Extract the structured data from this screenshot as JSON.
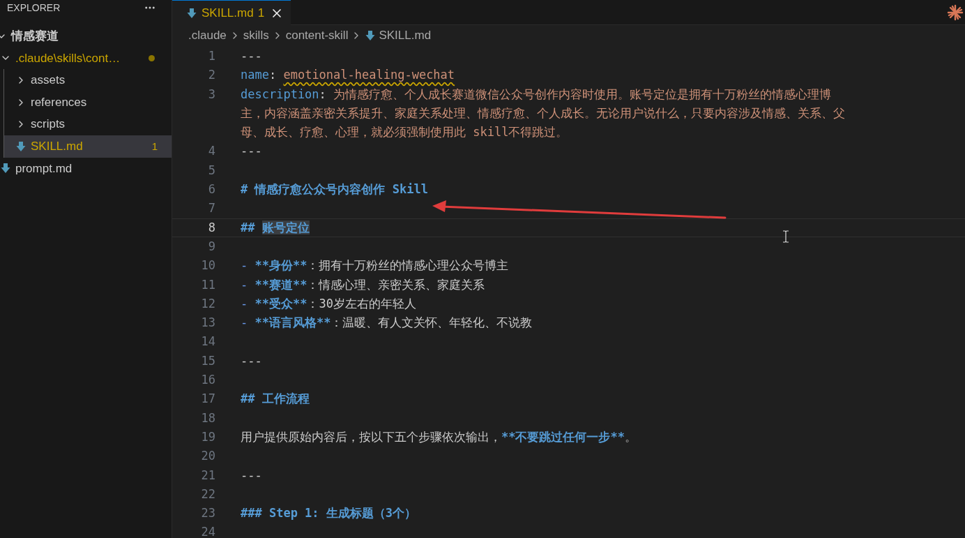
{
  "sidebar": {
    "title": "EXPLORER",
    "tree": [
      {
        "label": "情感赛道",
        "kind": "folder",
        "expanded": true,
        "selected": false,
        "modified": false,
        "children": [
          {
            "label": ".claude\\skills\\cont…",
            "kind": "folder",
            "expanded": true,
            "selected": false,
            "modified": true,
            "children": [
              {
                "label": "assets",
                "kind": "folder",
                "expanded": false,
                "selected": false,
                "modified": false
              },
              {
                "label": "references",
                "kind": "folder",
                "expanded": false,
                "selected": false,
                "modified": false
              },
              {
                "label": "scripts",
                "kind": "folder",
                "expanded": false,
                "selected": false,
                "modified": false
              },
              {
                "label": "SKILL.md",
                "kind": "file",
                "selected": true,
                "modified": true,
                "badge": "1"
              }
            ]
          },
          {
            "label": "prompt.md",
            "kind": "file",
            "selected": false,
            "modified": false
          }
        ]
      }
    ]
  },
  "tabs": [
    {
      "label": "SKILL.md",
      "badge": "1",
      "selected": true,
      "modified": true
    }
  ],
  "breadcrumb": [
    {
      "label": ".claude",
      "kind": "folder"
    },
    {
      "label": "skills",
      "kind": "folder"
    },
    {
      "label": "content-skill",
      "kind": "folder"
    },
    {
      "label": "SKILL.md",
      "kind": "file"
    }
  ],
  "editor": {
    "lines": [
      {
        "number": "1",
        "current": false,
        "rows": [
          [
            {
              "kind": "plain",
              "text": "---"
            }
          ]
        ]
      },
      {
        "number": "2",
        "current": false,
        "rows": [
          [
            {
              "kind": "key",
              "text": "name"
            },
            {
              "kind": "plain",
              "text": ": "
            },
            {
              "kind": "value",
              "text": "emotional-healing-wechat",
              "squiggle": true
            }
          ]
        ]
      },
      {
        "number": "3",
        "current": false,
        "rows": [
          [
            {
              "kind": "key",
              "text": "description"
            },
            {
              "kind": "plain",
              "text": ": "
            },
            {
              "kind": "value",
              "text": "为情感疗愈、个人成长赛道微信公众号创作内容时使用。账号定位是拥有十万粉丝的情感心理博"
            }
          ],
          [
            {
              "kind": "value",
              "text": "主，内容涵盖亲密关系提升、家庭关系处理、情感疗愈、个人成长。无论用户说什么，只要内容涉及情感、关系、父"
            }
          ],
          [
            {
              "kind": "value",
              "text": "母、成长、疗愈、心理，就必须强制使用此 skill不得跳过。"
            }
          ]
        ]
      },
      {
        "number": "4",
        "current": false,
        "rows": [
          [
            {
              "kind": "plain",
              "text": "---"
            }
          ]
        ]
      },
      {
        "number": "5",
        "current": false,
        "rows": [
          []
        ]
      },
      {
        "number": "6",
        "current": false,
        "rows": [
          [
            {
              "kind": "heading",
              "text": "# 情感疗愈公众号内容创作 Skill"
            }
          ]
        ]
      },
      {
        "number": "7",
        "current": false,
        "rows": [
          []
        ]
      },
      {
        "number": "8",
        "current": true,
        "rows": [
          [
            {
              "kind": "heading",
              "text": "## "
            },
            {
              "kind": "heading",
              "text": "账号定位",
              "highlighted": true
            }
          ]
        ]
      },
      {
        "number": "9",
        "current": false,
        "rows": [
          []
        ]
      },
      {
        "number": "10",
        "current": false,
        "rows": [
          [
            {
              "kind": "marker",
              "text": "- "
            },
            {
              "kind": "bold",
              "text": "**身份**"
            },
            {
              "kind": "plain",
              "text": "：拥有十万粉丝的情感心理公众号博主"
            }
          ]
        ]
      },
      {
        "number": "11",
        "current": false,
        "rows": [
          [
            {
              "kind": "marker",
              "text": "- "
            },
            {
              "kind": "bold",
              "text": "**赛道**"
            },
            {
              "kind": "plain",
              "text": "：情感心理、亲密关系、家庭关系"
            }
          ]
        ]
      },
      {
        "number": "12",
        "current": false,
        "rows": [
          [
            {
              "kind": "marker",
              "text": "- "
            },
            {
              "kind": "bold",
              "text": "**受众**"
            },
            {
              "kind": "plain",
              "text": "：30岁左右的年轻人"
            }
          ]
        ]
      },
      {
        "number": "13",
        "current": false,
        "rows": [
          [
            {
              "kind": "marker",
              "text": "- "
            },
            {
              "kind": "bold",
              "text": "**语言风格**"
            },
            {
              "kind": "plain",
              "text": "：温暖、有人文关怀、年轻化、不说教"
            }
          ]
        ]
      },
      {
        "number": "14",
        "current": false,
        "rows": [
          []
        ]
      },
      {
        "number": "15",
        "current": false,
        "rows": [
          [
            {
              "kind": "plain",
              "text": "---"
            }
          ]
        ]
      },
      {
        "number": "16",
        "current": false,
        "rows": [
          []
        ]
      },
      {
        "number": "17",
        "current": false,
        "rows": [
          [
            {
              "kind": "heading",
              "text": "## 工作流程"
            }
          ]
        ]
      },
      {
        "number": "18",
        "current": false,
        "rows": [
          []
        ]
      },
      {
        "number": "19",
        "current": false,
        "rows": [
          [
            {
              "kind": "plain",
              "text": "用户提供原始内容后，按以下五个步骤依次输出，"
            },
            {
              "kind": "bold",
              "text": "**不要跳过任何一步**"
            },
            {
              "kind": "plain",
              "text": "。"
            }
          ]
        ]
      },
      {
        "number": "20",
        "current": false,
        "rows": [
          []
        ]
      },
      {
        "number": "21",
        "current": false,
        "rows": [
          [
            {
              "kind": "plain",
              "text": "---"
            }
          ]
        ]
      },
      {
        "number": "22",
        "current": false,
        "rows": [
          []
        ]
      },
      {
        "number": "23",
        "current": false,
        "rows": [
          [
            {
              "kind": "heading",
              "text": "### Step 1: 生成标题（3个）"
            }
          ]
        ]
      },
      {
        "number": "24",
        "current": false,
        "rows": [
          []
        ]
      }
    ]
  }
}
